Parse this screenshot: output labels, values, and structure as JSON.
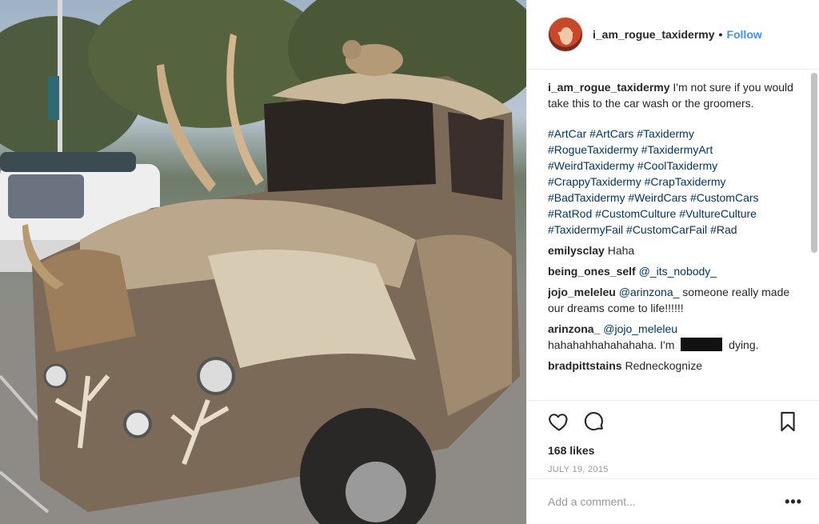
{
  "header": {
    "username": "i_am_rogue_taxidermy",
    "separator": "•",
    "follow_label": "Follow"
  },
  "caption": {
    "username": "i_am_rogue_taxidermy",
    "text": "I'm not sure if you would take this to the car wash or the groomers.",
    "hashtags": [
      "#ArtCar",
      "#ArtCars",
      "#Taxidermy",
      "#RogueTaxidermy",
      "#TaxidermyArt",
      "#WeirdTaxidermy",
      "#CoolTaxidermy",
      "#CrappyTaxidermy",
      "#CrapTaxidermy",
      "#BadTaxidermy",
      "#WeirdCars",
      "#CustomCars",
      "#RatRod",
      "#CustomCulture",
      "#VultureCulture",
      "#TaxidermyFail",
      "#CustomCarFail",
      "#Rad"
    ]
  },
  "comments": [
    {
      "user": "emilysclay",
      "mention": "",
      "text": "Haha"
    },
    {
      "user": "being_ones_self",
      "mention": "@_its_nobody_",
      "text": ""
    },
    {
      "user": "jojo_meleleu",
      "mention": "@arinzona_",
      "text": "someone really made our dreams come to life!!!!!!"
    },
    {
      "user": "arinzona_",
      "mention": "@jojo_meleleu",
      "text_before": "hahahahhahahahaha. I'm",
      "text_after": "dying."
    },
    {
      "user": "bradpittstains",
      "mention": "",
      "text": "Redneckognize"
    }
  ],
  "actions": {
    "like_icon": "heart-icon",
    "comment_icon": "speech-bubble-icon",
    "save_icon": "bookmark-icon"
  },
  "likes": "168 likes",
  "date": "JULY 19, 2015",
  "add_comment": {
    "placeholder": "Add a comment...",
    "more_label": "•••"
  }
}
